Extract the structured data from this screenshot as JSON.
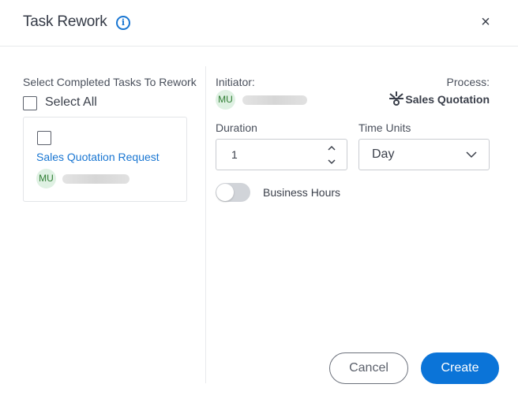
{
  "dialog": {
    "title": "Task Rework",
    "info_icon": "info-icon",
    "close_icon": "close-icon",
    "close_glyph": "×"
  },
  "left": {
    "label": "Select Completed Tasks To Rework",
    "select_all_label": "Select All",
    "select_all_checked": false,
    "tasks": [
      {
        "name": "Sales Quotation Request",
        "checked": false,
        "assignee_initials": "MU"
      }
    ]
  },
  "right": {
    "initiator_label": "Initiator:",
    "initiator_initials": "MU",
    "process_label": "Process:",
    "process_icon": "process-icon",
    "process_name": "Sales Quotation",
    "duration_label": "Duration",
    "duration_value": "1",
    "time_units_label": "Time Units",
    "time_units_value": "Day",
    "business_hours_label": "Business Hours",
    "business_hours_enabled": false
  },
  "footer": {
    "cancel_label": "Cancel",
    "create_label": "Create"
  },
  "colors": {
    "accent": "#0b74d8",
    "link": "#1976d2",
    "avatar_bg": "#dff1e3",
    "avatar_text": "#2e7d32"
  }
}
